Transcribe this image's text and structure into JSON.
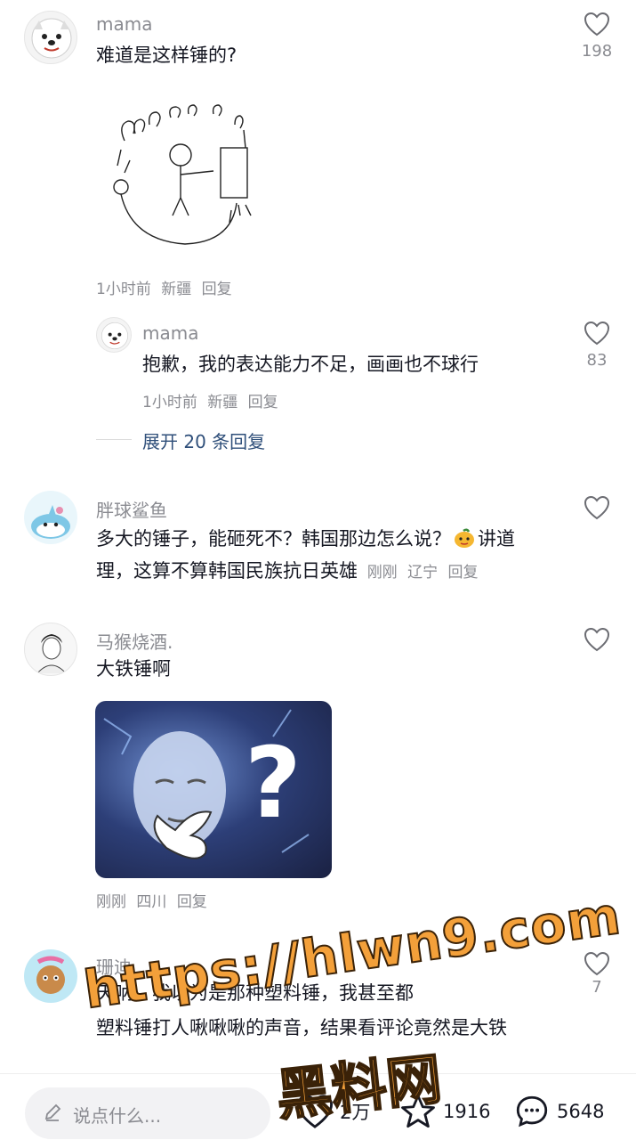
{
  "comments": [
    {
      "author": "mama",
      "text": "难道是这样锤的?",
      "time": "1小时前",
      "location": "新疆",
      "reply": "回复",
      "likes": "198",
      "sub": {
        "author": "mama",
        "text": "抱歉，我的表达能力不足，画画也不球行",
        "time": "1小时前",
        "location": "新疆",
        "reply": "回复",
        "likes": "83"
      },
      "expand_label": "展开 20 条回复"
    },
    {
      "author": "胖球鲨鱼",
      "text_a": "多大的锤子，能砸死不？韩国那边怎么说？",
      "text_b": "讲道",
      "text_c": "理，这算不算韩国民族抗日英雄",
      "time": "刚刚",
      "location": "辽宁",
      "reply": "回复"
    },
    {
      "author": "马猴烧酒.",
      "text": "大铁锤啊",
      "time": "刚刚",
      "location": "四川",
      "reply": "回复"
    },
    {
      "author": "珊迪",
      "text_line1": "天呐，我以为是那种塑料锤，我甚至都",
      "text_line2": "塑料锤打人啾啾啾的声音，结果看评论竟然是大铁",
      "likes": "7"
    }
  ],
  "bottom_bar": {
    "placeholder": "说点什么...",
    "likes": "2万",
    "favorites": "1916",
    "comments": "5648"
  },
  "watermark": {
    "url": "https://hlwn9.com",
    "name": "黑料网"
  },
  "colors": {
    "link": "#2f4f7a",
    "muted": "#8a8b91",
    "watermark": "#f3a03a"
  }
}
